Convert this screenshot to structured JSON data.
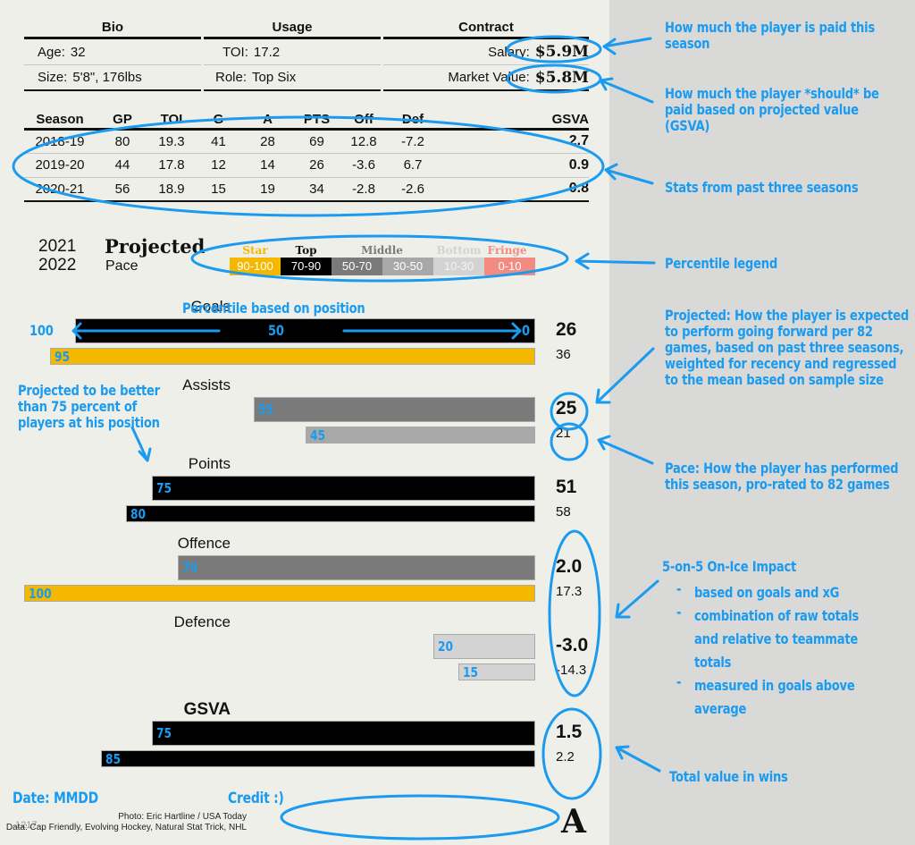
{
  "bio": {
    "heading": "Bio",
    "rows": [
      {
        "label": "Age:",
        "value": "32"
      },
      {
        "label": "Size:",
        "value": "5'8\", 176lbs"
      }
    ]
  },
  "usage": {
    "heading": "Usage",
    "rows": [
      {
        "label": "TOI:",
        "value": "17.2"
      },
      {
        "label": "Role:",
        "value": "Top Six"
      }
    ]
  },
  "contract": {
    "heading": "Contract",
    "rows": [
      {
        "label": "Salary:",
        "value": "$5.9M"
      },
      {
        "label": "Market Value:",
        "value": "$5.8M"
      }
    ]
  },
  "season_table": {
    "columns": [
      "Season",
      "GP",
      "TOI",
      "G",
      "A",
      "PTS",
      "Off",
      "Def",
      "GSVA"
    ],
    "rows": [
      [
        "2018-19",
        "80",
        "19.3",
        "41",
        "28",
        "69",
        "12.8",
        "-7.2",
        "2.7"
      ],
      [
        "2019-20",
        "44",
        "17.8",
        "12",
        "14",
        "26",
        "-3.6",
        "6.7",
        "0.9"
      ],
      [
        "2020-21",
        "56",
        "18.9",
        "15",
        "19",
        "34",
        "-2.8",
        "-2.6",
        "0.8"
      ]
    ]
  },
  "header": {
    "year_top": "2021",
    "year_bottom": "2022",
    "title": "Projected",
    "subtitle": "Pace"
  },
  "legend": [
    {
      "tier": "Star",
      "range": "90-100",
      "color": "#f5b800",
      "title_color": "#f5b800"
    },
    {
      "tier": "Top",
      "range": "70-90",
      "color": "#000000",
      "title_color": "#111111"
    },
    {
      "tier": "Middle",
      "range": "50-70",
      "color": "#7a7a7a",
      "title_color": "#7a7a7a"
    },
    {
      "tier": "",
      "range": "30-50",
      "color": "#a8a8a8",
      "title_color": "#a8a8a8"
    },
    {
      "tier": "Bottom",
      "range": "10-30",
      "color": "#d3d3d3",
      "title_color": "#d3d3d3"
    },
    {
      "tier": "Fringe",
      "range": "0-10",
      "color": "#f28c82",
      "title_color": "#f28c82"
    }
  ],
  "chart_data": {
    "type": "bar",
    "orientation": "horizontal",
    "xlabel": "Percentile based on position",
    "xlim": [
      0,
      100
    ],
    "axis_direction": "100 at left, 0 at right",
    "series": [
      {
        "name": "Projected"
      },
      {
        "name": "Pace"
      }
    ],
    "metrics": [
      {
        "name": "Goals",
        "projected": {
          "percentile": 90,
          "value": "26"
        },
        "pace": {
          "percentile": 95,
          "value": "36"
        }
      },
      {
        "name": "Assists",
        "projected": {
          "percentile": 55,
          "value": "25"
        },
        "pace": {
          "percentile": 45,
          "value": "21"
        }
      },
      {
        "name": "Points",
        "projected": {
          "percentile": 75,
          "value": "51"
        },
        "pace": {
          "percentile": 80,
          "value": "58"
        }
      },
      {
        "name": "Offence",
        "projected": {
          "percentile": 70,
          "value": "2.0"
        },
        "pace": {
          "percentile": 100,
          "value": "17.3"
        }
      },
      {
        "name": "Defence",
        "projected": {
          "percentile": 20,
          "value": "-3.0"
        },
        "pace": {
          "percentile": 15,
          "value": "-14.3"
        }
      },
      {
        "name": "GSVA",
        "projected": {
          "percentile": 75,
          "value": "1.5"
        },
        "pace": {
          "percentile": 85,
          "value": "2.2"
        }
      }
    ]
  },
  "axis_annotation": {
    "left": "100",
    "middle": "50",
    "right": "0",
    "title": "Percentile based on position"
  },
  "footer": {
    "date_code": "1217",
    "photo_credit": "Photo: Eric Hartline / USA Today",
    "data_credit": "Data: Cap Friendly, Evolving Hockey, Natural Stat Trick, NHL",
    "logo": "A"
  },
  "annotations": {
    "salary": "How much the player is paid this season",
    "market_value": "How much the player *should* be paid based on projected value (GSVA)",
    "stats": "Stats from past three seasons",
    "legend": "Percentile legend",
    "projected": "Projected: How the player is expected to perform going forward per 82 games, based on past three seasons, weighted for recency and regressed to the mean based on sample size",
    "pace": "Pace: How the player has performed this season, pro-rated to 82 games",
    "impact_title": "5-on-5 On-Ice Impact",
    "impact_points": [
      "based on goals and xG",
      "combination of raw totals and relative to teammate totals",
      "measured in goals above average"
    ],
    "gsva": "Total value in wins",
    "percentile_note": "Projected to be better than 75 percent of players at his position",
    "date": "Date: MMDD",
    "credit": "Credit :)"
  }
}
